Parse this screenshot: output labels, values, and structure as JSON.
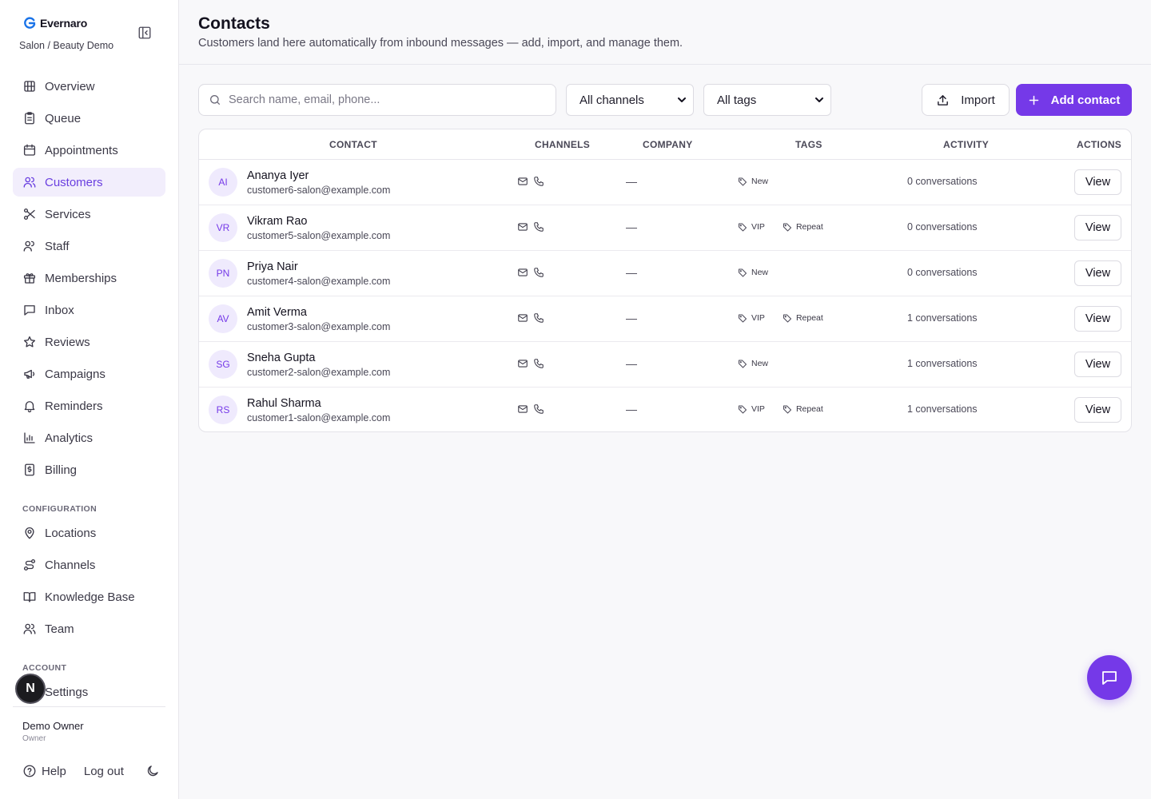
{
  "brand": {
    "name": "Evernaro",
    "workspace": "Salon / Beauty Demo"
  },
  "nav_main": [
    {
      "label": "Overview",
      "icon": "building-icon"
    },
    {
      "label": "Queue",
      "icon": "clipboard-icon"
    },
    {
      "label": "Appointments",
      "icon": "calendar-icon"
    },
    {
      "label": "Customers",
      "icon": "users-icon",
      "active": true
    },
    {
      "label": "Services",
      "icon": "scissors-icon"
    },
    {
      "label": "Staff",
      "icon": "user-icon"
    },
    {
      "label": "Memberships",
      "icon": "gift-icon"
    },
    {
      "label": "Inbox",
      "icon": "message-square-icon"
    },
    {
      "label": "Reviews",
      "icon": "star-icon"
    },
    {
      "label": "Campaigns",
      "icon": "megaphone-icon"
    },
    {
      "label": "Reminders",
      "icon": "bell-icon"
    },
    {
      "label": "Analytics",
      "icon": "bar-chart-icon"
    },
    {
      "label": "Billing",
      "icon": "receipt-icon"
    }
  ],
  "configuration": {
    "label": "CONFIGURATION",
    "items": [
      {
        "label": "Locations",
        "icon": "map-pin-icon"
      },
      {
        "label": "Channels",
        "icon": "route-icon"
      },
      {
        "label": "Knowledge Base",
        "icon": "book-open-icon"
      },
      {
        "label": "Team",
        "icon": "team-icon"
      }
    ]
  },
  "account": {
    "label": "ACCOUNT",
    "items": [
      {
        "label": "Settings",
        "icon": "settings-icon"
      }
    ]
  },
  "badge": "N",
  "user": {
    "name": "Demo Owner",
    "role": "Owner"
  },
  "footer": {
    "help": "Help",
    "logout": "Log out"
  },
  "header": {
    "title": "Contacts",
    "subtitle": "Customers land here automatically from inbound messages — add, import, and manage them."
  },
  "toolbar": {
    "search_placeholder": "Search name, email, phone...",
    "channel_filter": "All channels",
    "tag_filter": "All tags",
    "import_label": "Import",
    "add_label": "Add contact"
  },
  "table": {
    "columns": {
      "contact": "CONTACT",
      "channels": "CHANNELS",
      "company": "COMPANY",
      "tags": "TAGS",
      "activity": "ACTIVITY",
      "actions": "ACTIONS"
    },
    "rows": [
      {
        "initials": "AI",
        "name": "Ananya Iyer",
        "email": "customer6-salon@example.com",
        "company": "—",
        "tags": [
          "New"
        ],
        "activity": "0 conversations",
        "action": "View"
      },
      {
        "initials": "VR",
        "name": "Vikram Rao",
        "email": "customer5-salon@example.com",
        "company": "—",
        "tags": [
          "VIP",
          "Repeat"
        ],
        "activity": "0 conversations",
        "action": "View"
      },
      {
        "initials": "PN",
        "name": "Priya Nair",
        "email": "customer4-salon@example.com",
        "company": "—",
        "tags": [
          "New"
        ],
        "activity": "0 conversations",
        "action": "View"
      },
      {
        "initials": "AV",
        "name": "Amit Verma",
        "email": "customer3-salon@example.com",
        "company": "—",
        "tags": [
          "VIP",
          "Repeat"
        ],
        "activity": "1 conversations",
        "action": "View"
      },
      {
        "initials": "SG",
        "name": "Sneha Gupta",
        "email": "customer2-salon@example.com",
        "company": "—",
        "tags": [
          "New"
        ],
        "activity": "1 conversations",
        "action": "View"
      },
      {
        "initials": "RS",
        "name": "Rahul Sharma",
        "email": "customer1-salon@example.com",
        "company": "—",
        "tags": [
          "VIP",
          "Repeat"
        ],
        "activity": "1 conversations",
        "action": "View"
      }
    ]
  },
  "colors": {
    "accent": "#7539e8",
    "active_bg": "#f2eefc"
  }
}
